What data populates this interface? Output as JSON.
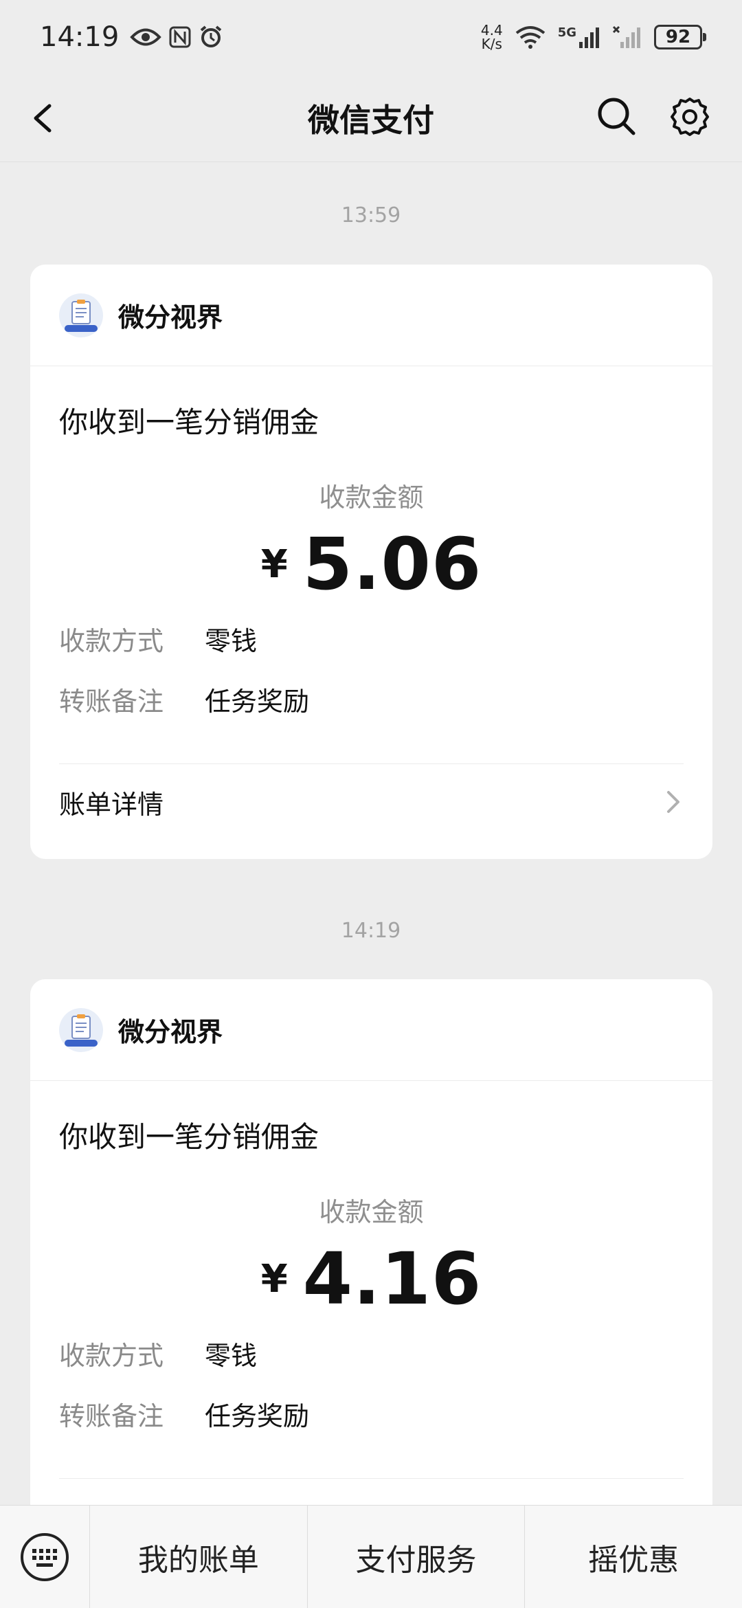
{
  "status_bar": {
    "time": "14:19",
    "net_speed_value": "4.4",
    "net_speed_unit": "K/s",
    "network_label": "5G",
    "battery": "92"
  },
  "nav": {
    "title": "微信支付"
  },
  "messages": [
    {
      "time": "13:59",
      "merchant": "微分视界",
      "title": "你收到一笔分销佣金",
      "amount_label": "收款金额",
      "currency": "¥",
      "amount": "5.06",
      "method_label": "收款方式",
      "method_value": "零钱",
      "note_label": "转账备注",
      "note_value": "任务奖励",
      "bill_link": "账单详情"
    },
    {
      "time": "14:19",
      "merchant": "微分视界",
      "title": "你收到一笔分销佣金",
      "amount_label": "收款金额",
      "currency": "¥",
      "amount": "4.16",
      "method_label": "收款方式",
      "method_value": "零钱",
      "note_label": "转账备注",
      "note_value": "任务奖励"
    }
  ],
  "bottom_menu": {
    "items": [
      "我的账单",
      "支付服务",
      "摇优惠"
    ]
  }
}
